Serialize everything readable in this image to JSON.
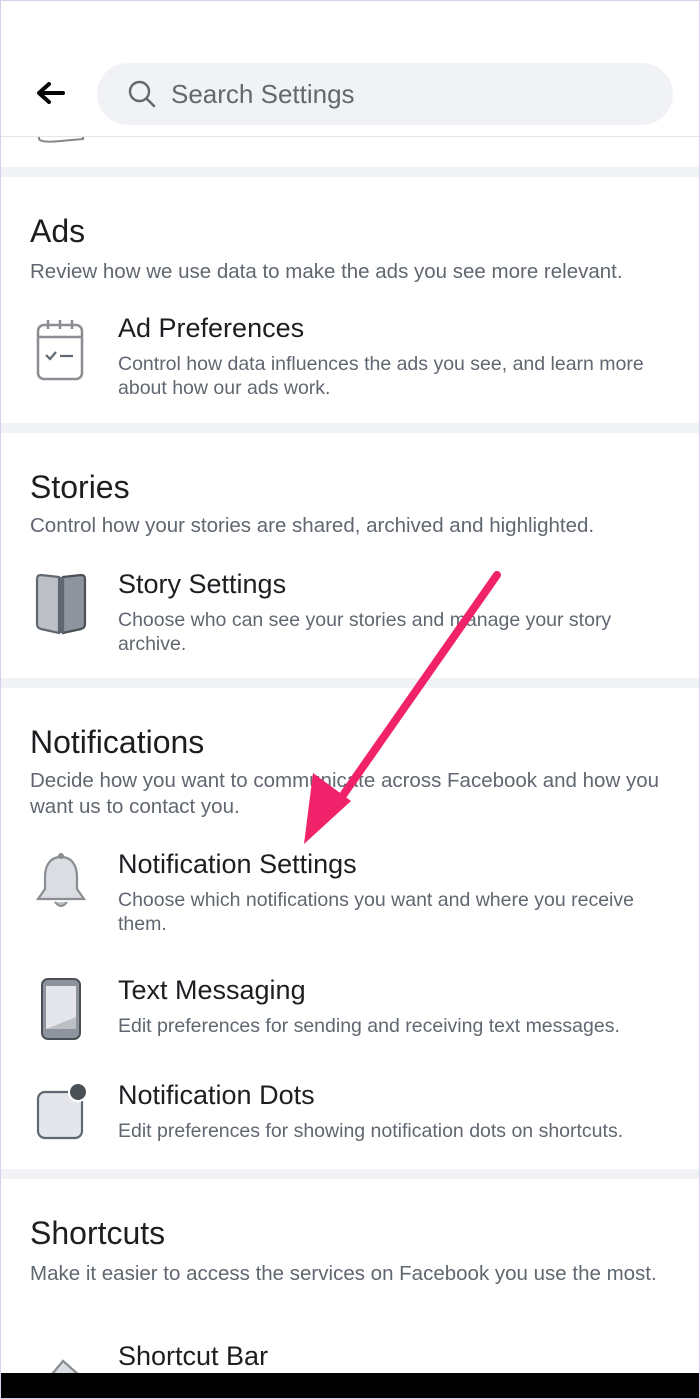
{
  "search": {
    "placeholder": "Search Settings"
  },
  "sections": {
    "ads": {
      "title": "Ads",
      "description": "Review how we use data to make the ads you see more relevant.",
      "items": [
        {
          "title": "Ad Preferences",
          "description": "Control how data influences the ads you see, and learn more about how our ads work.",
          "icon": "calendar-check-icon"
        }
      ]
    },
    "stories": {
      "title": "Stories",
      "description": "Control how your stories are shared, archived and highlighted.",
      "items": [
        {
          "title": "Story Settings",
          "description": "Choose who can see your stories and manage your story archive.",
          "icon": "book-icon"
        }
      ]
    },
    "notifications": {
      "title": "Notifications",
      "description": "Decide how you want to communicate across Facebook and how you want us to contact you.",
      "items": [
        {
          "title": "Notification Settings",
          "description": "Choose which notifications you want and where you receive them.",
          "icon": "bell-icon"
        },
        {
          "title": "Text Messaging",
          "description": "Edit preferences for sending and receiving text messages.",
          "icon": "phone-icon"
        },
        {
          "title": "Notification Dots",
          "description": "Edit preferences for showing notification dots on shortcuts.",
          "icon": "notification-dot-icon"
        }
      ]
    },
    "shortcuts": {
      "title": "Shortcuts",
      "description": "Make it easier to access the services on Facebook you use the most.",
      "items": [
        {
          "title": "Shortcut Bar",
          "icon": "pin-icon"
        }
      ]
    }
  },
  "colors": {
    "annotation_arrow": "#f0226a",
    "divider": "#f0f2f5",
    "secondary_text": "#606770"
  }
}
